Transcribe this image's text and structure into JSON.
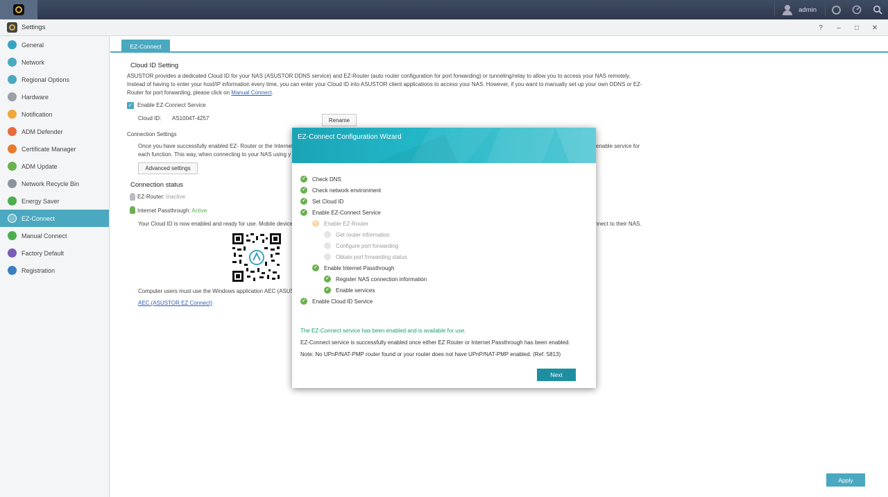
{
  "topbar": {
    "user": "admin",
    "icons": [
      "user-icon",
      "notification-icon",
      "dashboard-icon",
      "search-icon"
    ]
  },
  "window": {
    "title": "Settings",
    "controls": [
      "?",
      "–",
      "□",
      "✕"
    ]
  },
  "sidebar": {
    "items": [
      {
        "label": "General",
        "icon": "general-icon",
        "color": "#3aa3c4"
      },
      {
        "label": "Network",
        "icon": "network-icon",
        "color": "#4aa8c0"
      },
      {
        "label": "Regional Options",
        "icon": "regional-icon",
        "color": "#4aa8c0"
      },
      {
        "label": "Hardware",
        "icon": "hardware-icon",
        "color": "#9aa0a6"
      },
      {
        "label": "Notification",
        "icon": "notification-icon",
        "color": "#f0a73a"
      },
      {
        "label": "ADM Defender",
        "icon": "defender-icon",
        "color": "#e86a3a"
      },
      {
        "label": "Certificate Manager",
        "icon": "certificate-icon",
        "color": "#e87a2a"
      },
      {
        "label": "ADM Update",
        "icon": "update-icon",
        "color": "#6ab04c"
      },
      {
        "label": "Network Recycle Bin",
        "icon": "recycle-bin-icon",
        "color": "#8a94a0"
      },
      {
        "label": "Energy Saver",
        "icon": "energy-icon",
        "color": "#4cae4c"
      },
      {
        "label": "EZ-Connect",
        "icon": "ez-connect-icon",
        "color": "#ffffff",
        "active": true
      },
      {
        "label": "Manual Connect",
        "icon": "manual-connect-icon",
        "color": "#4cae4c"
      },
      {
        "label": "Factory Default",
        "icon": "factory-default-icon",
        "color": "#7b5cb8"
      },
      {
        "label": "Registration",
        "icon": "registration-icon",
        "color": "#3a7fc4"
      }
    ]
  },
  "main": {
    "tab": "EZ-Connect",
    "cloud_heading": "Cloud ID Setting",
    "desc1": "ASUSTOR provides a dedicated Cloud ID for your NAS (ASUSTOR DDNS service) and EZ-Router (auto router configuration for port forwarding) or tunneling/relay to allow you to access your NAS remotely.",
    "desc2": "Instead of having to enter your host/IP information every time, you can enter your Cloud ID into ASUSTOR client applications to access your NAS. However, if you want to manually set up your own DDNS or EZ-",
    "desc3": "Router for port forwarding, please click on ",
    "desc3_link": "Manual Connect",
    "desc3_end": ".",
    "enable_label": "Enable EZ-Connect Service",
    "cloud_id_label": "Cloud ID:",
    "cloud_id_value": "AS1004T-4257",
    "rename": "Rename",
    "conn_settings": "Connection Settings",
    "conn_desc1": "Once you have successfully enabled EZ- Router or the Internet",
    "conn_desc1_end": "enable service for",
    "conn_desc2": "each function. This way, when connecting to your NAS using y",
    "advanced": "Advanced settings",
    "status_heading": "Connection status",
    "ez_router_label": "EZ-Router:",
    "ez_router_status": "Inactive",
    "passthrough_label": "Internet Passthrough:",
    "passthrough_status": "Active",
    "cloud_enabled": "Your Cloud ID is now enabled and ready for use. Mobile device",
    "cloud_enabled_end": "connect to their NAS.",
    "computer_users": "Computer users must use the Windows application AEC (ASUS",
    "aec_link": "AEC (ASUSTOR EZ Connect)",
    "apply": "Apply"
  },
  "wizard": {
    "title": "EZ-Connect Configuration Wizard",
    "steps": [
      {
        "label": "Check DNS",
        "state": "ok",
        "level": 0
      },
      {
        "label": "Check network environment",
        "state": "ok",
        "level": 0
      },
      {
        "label": "Set Cloud ID",
        "state": "ok",
        "level": 0
      },
      {
        "label": "Enable EZ-Connect Service",
        "state": "ok",
        "level": 0
      },
      {
        "label": "Enable EZ-Router",
        "state": "warn",
        "level": 1
      },
      {
        "label": "Get router information",
        "state": "pending",
        "level": 2
      },
      {
        "label": "Configure port forwarding",
        "state": "pending",
        "level": 2
      },
      {
        "label": "Obtain port forwarding status",
        "state": "pending",
        "level": 2
      },
      {
        "label": "Enable Internet Passthrough",
        "state": "ok",
        "level": 1
      },
      {
        "label": "Register NAS connection information",
        "state": "ok",
        "level": 2
      },
      {
        "label": "Enable services",
        "state": "ok",
        "level": 2
      },
      {
        "label": "Enable Cloud ID Service",
        "state": "ok",
        "level": 0
      }
    ],
    "msg_success": "The EZ-Connect service has been enabled and is available for use.",
    "msg_info": "EZ-Connect service is successfully enabled once either EZ Router or Internet Passthrough has been enabled.",
    "msg_note": "Note: No UPnP/NAT-PMP router found or your router does not have UPnP/NAT-PMP enabled. (Ref. 5813)",
    "next": "Next"
  }
}
